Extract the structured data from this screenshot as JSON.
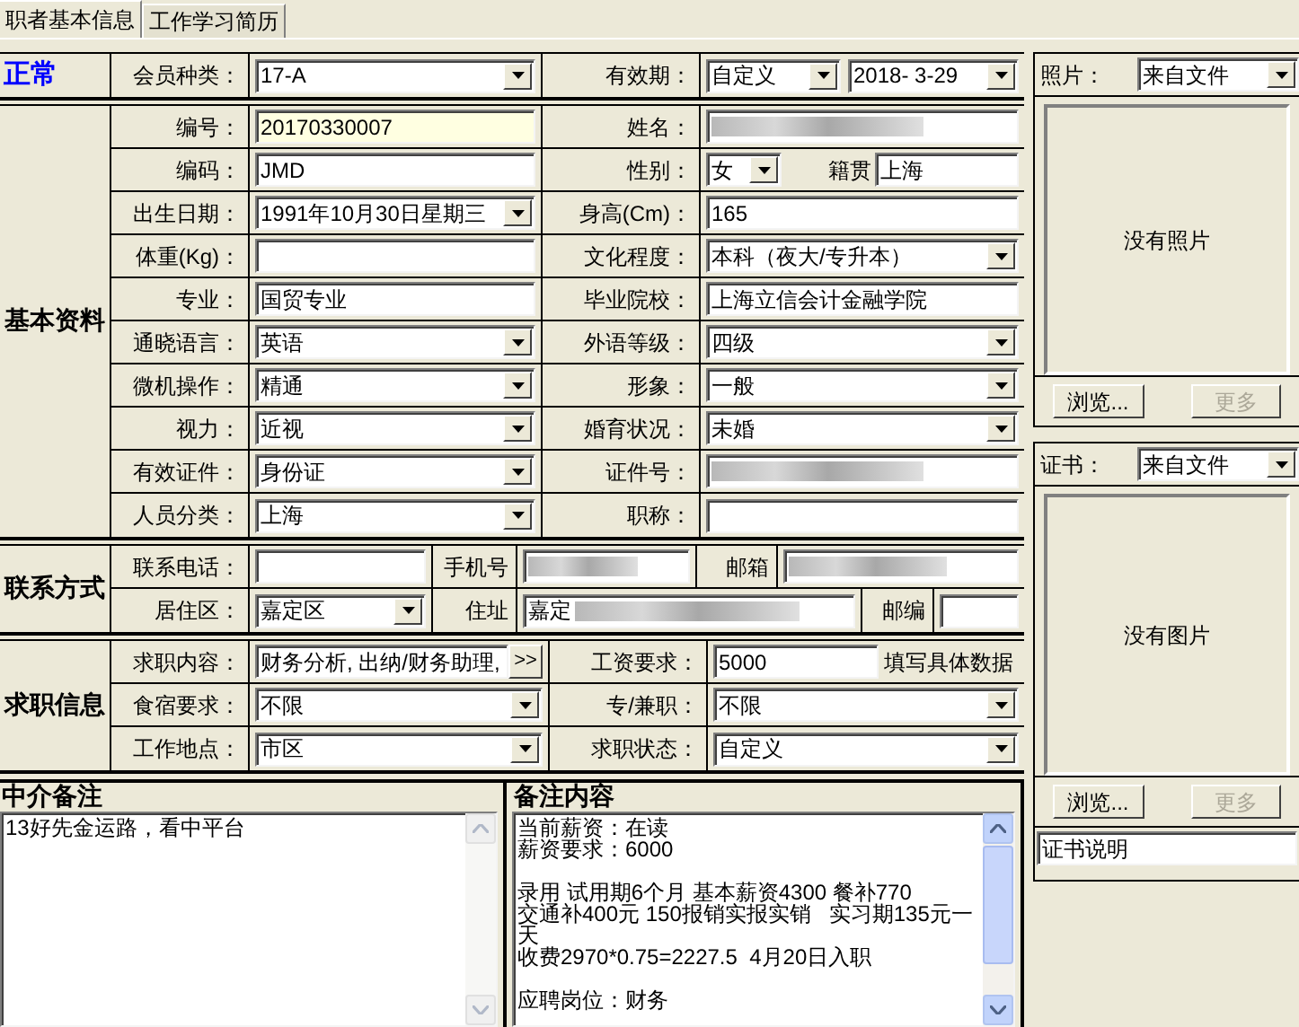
{
  "tabs": [
    {
      "label": "职者基本信息",
      "selected": true
    },
    {
      "label": "工作学习简历",
      "selected": false
    }
  ],
  "header": {
    "status": "正常",
    "cells": [
      {
        "kind": "label",
        "text": "会员种类："
      },
      {
        "kind": "combo",
        "value": "17-A"
      },
      {
        "kind": "label",
        "text": "有效期："
      },
      {
        "kind": "combo_pair",
        "values": [
          "自定义",
          "2018- 3-29"
        ]
      }
    ]
  },
  "basic_info": {
    "title": "基本资料",
    "rows": [
      [
        {
          "kind": "label",
          "text": "编号："
        },
        {
          "kind": "text",
          "value": "20170330007",
          "highlighted": true
        },
        {
          "kind": "label",
          "text": "姓名："
        },
        {
          "kind": "redacted"
        }
      ],
      [
        {
          "kind": "label",
          "text": "编码："
        },
        {
          "kind": "text",
          "value": "JMD",
          "highlighted": false
        },
        {
          "kind": "label",
          "text": "性别："
        },
        {
          "kind": "combo_with_field",
          "value": "女",
          "label": "籍贯",
          "field_value": "上海"
        }
      ],
      [
        {
          "kind": "label",
          "text": "出生日期："
        },
        {
          "kind": "combo",
          "value": "1991年10月30日星期三"
        },
        {
          "kind": "label",
          "text": "身高(Cm)："
        },
        {
          "kind": "text",
          "value": "165",
          "highlighted": false
        }
      ],
      [
        {
          "kind": "label",
          "text": "体重(Kg)："
        },
        {
          "kind": "text",
          "highlighted": false
        },
        {
          "kind": "label",
          "text": "文化程度："
        },
        {
          "kind": "combo",
          "value": "本科（夜大/专升本）"
        }
      ],
      [
        {
          "kind": "label",
          "text": "专业："
        },
        {
          "kind": "text",
          "value": "国贸专业",
          "highlighted": false
        },
        {
          "kind": "label",
          "text": "毕业院校："
        },
        {
          "kind": "text",
          "value": "上海立信会计金融学院",
          "highlighted": false
        }
      ],
      [
        {
          "kind": "label",
          "text": "通晓语言："
        },
        {
          "kind": "combo",
          "value": "英语"
        },
        {
          "kind": "label",
          "text": "外语等级："
        },
        {
          "kind": "combo",
          "value": "四级"
        }
      ],
      [
        {
          "kind": "label",
          "text": "微机操作："
        },
        {
          "kind": "combo",
          "value": "精通"
        },
        {
          "kind": "label",
          "text": "形象："
        },
        {
          "kind": "combo",
          "value": "一般"
        }
      ],
      [
        {
          "kind": "label",
          "text": "视力："
        },
        {
          "kind": "combo",
          "value": "近视"
        },
        {
          "kind": "label",
          "text": "婚育状况："
        },
        {
          "kind": "combo",
          "value": "未婚"
        }
      ],
      [
        {
          "kind": "label",
          "text": "有效证件："
        },
        {
          "kind": "combo",
          "value": "身份证"
        },
        {
          "kind": "label",
          "text": "证件号："
        },
        {
          "kind": "redacted"
        }
      ],
      [
        {
          "kind": "label",
          "text": "人员分类："
        },
        {
          "kind": "combo",
          "value": "上海"
        },
        {
          "kind": "label",
          "text": "职称："
        },
        {
          "kind": "text",
          "highlighted": false
        }
      ]
    ]
  },
  "contact": {
    "title": "联系方式",
    "rows": [
      [
        {
          "kind": "label",
          "text": "联系电话："
        },
        {
          "kind": "text"
        },
        {
          "kind": "label",
          "text": "手机号"
        },
        {
          "kind": "redacted"
        },
        {
          "kind": "label",
          "text": "邮箱"
        },
        {
          "kind": "redacted"
        }
      ],
      [
        {
          "kind": "label",
          "text": "居住区："
        },
        {
          "kind": "combo",
          "value": "嘉定区"
        },
        {
          "kind": "label",
          "text": "住址"
        },
        {
          "kind": "text_redacted",
          "value": "嘉定"
        },
        {
          "kind": "label",
          "text": "邮编"
        },
        {
          "kind": "text"
        }
      ]
    ]
  },
  "job": {
    "title": "求职信息",
    "rows": [
      [
        {
          "kind": "label",
          "text": "求职内容："
        },
        {
          "kind": "text_button",
          "value": "财务分析, 出纳/财务助理,",
          "button": ">>"
        },
        {
          "kind": "label",
          "text": "工资要求："
        },
        {
          "kind": "text_note",
          "value": "5000",
          "note": "填写具体数据"
        }
      ],
      [
        {
          "kind": "label",
          "text": "食宿要求："
        },
        {
          "kind": "combo",
          "value": "不限"
        },
        {
          "kind": "label",
          "text": "专/兼职："
        },
        {
          "kind": "combo",
          "value": "不限"
        }
      ],
      [
        {
          "kind": "label",
          "text": "工作地点："
        },
        {
          "kind": "combo",
          "value": "市区"
        },
        {
          "kind": "label",
          "text": "求职状态："
        },
        {
          "kind": "combo",
          "value": "自定义"
        }
      ]
    ]
  },
  "agency_note": {
    "title": "中介备注",
    "text": "13好先金运路，看中平台"
  },
  "remarks": {
    "title": "备注内容",
    "paragraphs": [
      [
        "当前薪资：在读",
        "薪资要求：6000"
      ],
      [
        "录用 试用期6个月 基本薪资4300 餐补770",
        "交通补400元 150报销实报实销   实习期135元一",
        "天",
        "收费2970*0.75=2227.5  4月20日入职"
      ],
      [
        "应聘岗位：财务"
      ]
    ]
  },
  "photo": {
    "label": "照片：",
    "source": "来自文件",
    "empty_text": "没有照片",
    "buttons": [
      {
        "label": "浏览...",
        "disabled": false
      },
      {
        "label": "更多",
        "disabled": true
      }
    ]
  },
  "certificate": {
    "label": "证书：",
    "source": "来自文件",
    "empty_text": "没有图片",
    "buttons": [
      {
        "label": "浏览...",
        "disabled": false
      },
      {
        "label": "更多",
        "disabled": true
      }
    ],
    "caption": "证书说明"
  }
}
